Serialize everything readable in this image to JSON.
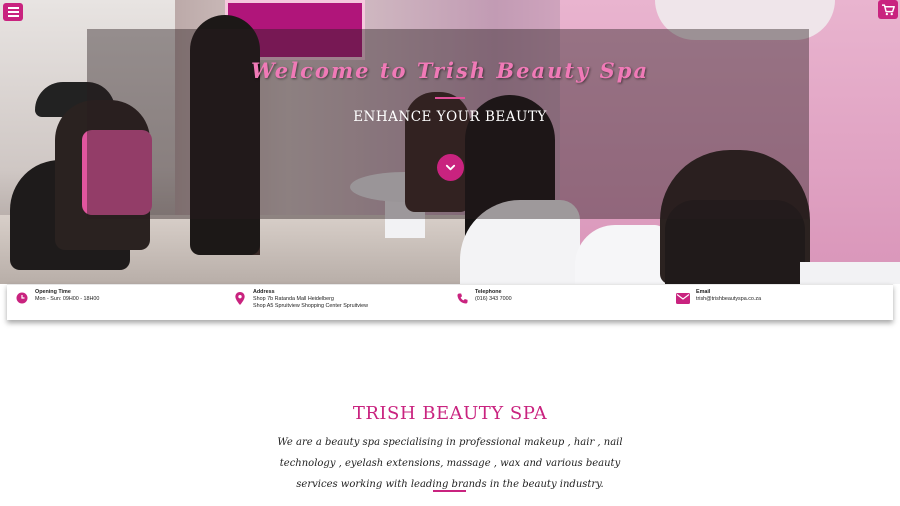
{
  "hero": {
    "title": "Welcome to Trish Beauty Spa",
    "subtitle": "ENHANCE YOUR BEAUTY",
    "scroll_icon": "chevron-down-icon"
  },
  "nav": {
    "menu_icon": "hamburger-menu-icon",
    "cart_icon": "shopping-cart-icon"
  },
  "info": {
    "items": [
      {
        "icon": "clock-icon",
        "label": "Opening Time",
        "lines": [
          "Mon - Sun: 09H00 - 18H00"
        ]
      },
      {
        "icon": "map-pin-icon",
        "label": "Address",
        "lines": [
          "Shop 7b Ratanda Mall Heidelberg",
          "Shop A5 Spruitview Shopping Center Spruitview"
        ]
      },
      {
        "icon": "phone-icon",
        "label": "Telephone",
        "lines": [
          "(016) 343 7000"
        ]
      },
      {
        "icon": "envelope-icon",
        "label": "Email",
        "lines": [
          "trish@trishbeautyspa.co.za"
        ]
      }
    ]
  },
  "about": {
    "title": "TRISH BEAUTY SPA",
    "text": "We are a beauty spa specialising in professional makeup , hair , nail technology , eyelash extensions, massage , wax and various beauty services working with leading brands in the beauty industry."
  },
  "colors": {
    "accent": "#c9237f",
    "hero_title": "#f07ab7"
  }
}
